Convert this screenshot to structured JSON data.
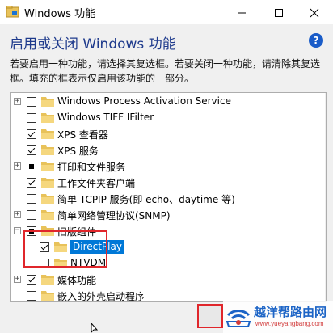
{
  "window": {
    "title": "Windows 功能",
    "icon": "windows-features-icon",
    "controls": {
      "minimize": "minimize-icon",
      "maximize": "maximize-icon",
      "close": "close-icon"
    }
  },
  "heading": "启用或关闭 Windows 功能",
  "help_label": "?",
  "description": "若要启用一种功能，请选择其复选框。若要关闭一种功能，请清除其复选框。填充的框表示仅启用该功能的一部分。",
  "tree": [
    {
      "label": "Windows Process Activation Service",
      "expander": "+",
      "state": "unchecked"
    },
    {
      "label": "Windows TIFF IFilter",
      "expander": "",
      "state": "unchecked"
    },
    {
      "label": "XPS 查看器",
      "expander": "",
      "state": "checked"
    },
    {
      "label": "XPS 服务",
      "expander": "",
      "state": "checked"
    },
    {
      "label": "打印和文件服务",
      "expander": "+",
      "state": "partial"
    },
    {
      "label": "工作文件夹客户端",
      "expander": "",
      "state": "checked"
    },
    {
      "label": "简单 TCPIP 服务(即 echo、daytime 等)",
      "expander": "",
      "state": "unchecked"
    },
    {
      "label": "简单网络管理协议(SNMP)",
      "expander": "+",
      "state": "unchecked"
    },
    {
      "label": "旧版组件",
      "expander": "−",
      "state": "partial"
    },
    {
      "label": "DirectPlay",
      "expander": "",
      "state": "checked",
      "selected": true
    },
    {
      "label": "NTVDM",
      "expander": "",
      "state": "unchecked"
    },
    {
      "label": "媒体功能",
      "expander": "+",
      "state": "checked"
    },
    {
      "label": "嵌入的外壳启动程序",
      "expander": "",
      "state": "unchecked"
    }
  ],
  "scrollbar": {
    "up": "▲",
    "down": "▼"
  },
  "watermark": {
    "title": "越洋帮路由网",
    "url": "www.yueyangbang.com",
    "logo": "wifi-router-logo"
  },
  "colors": {
    "accent": "#0078d7",
    "heading": "#1e3a8c",
    "highlight_border": "#e0262b",
    "folder": "#e8c25a"
  }
}
